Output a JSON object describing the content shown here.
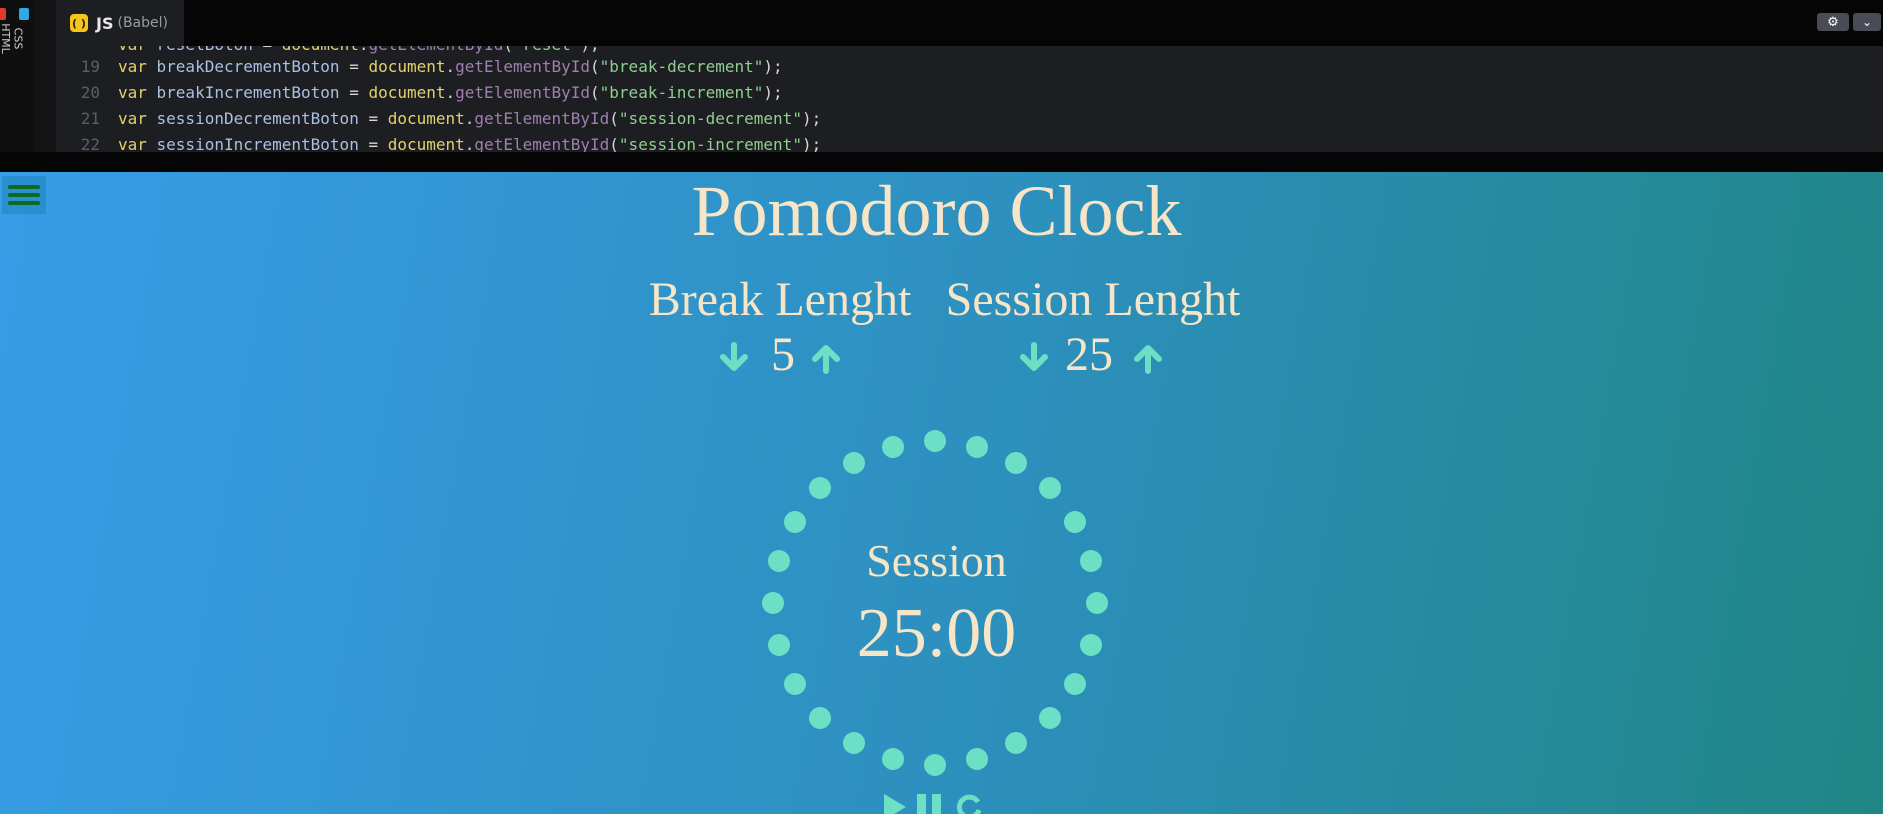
{
  "editor": {
    "vertical_tabs": [
      "HTML",
      "CSS"
    ],
    "active_tab": {
      "title": "JS",
      "subtitle": "(Babel)"
    },
    "code_lines": [
      {
        "num": "",
        "tokens": [
          {
            "t": "var ",
            "c": "kw"
          },
          {
            "t": "resetBoton ",
            "c": "vn"
          },
          {
            "t": "= ",
            "c": "op"
          },
          {
            "t": "document",
            "c": "kw"
          },
          {
            "t": ".",
            "c": "op"
          },
          {
            "t": "getElementById",
            "c": "fn"
          },
          {
            "t": "(",
            "c": "op"
          },
          {
            "t": "\"reset\"",
            "c": "str"
          },
          {
            "t": ");",
            "c": "op"
          }
        ]
      },
      {
        "num": "19",
        "tokens": [
          {
            "t": "var ",
            "c": "kw"
          },
          {
            "t": "breakDecrementBoton ",
            "c": "vn"
          },
          {
            "t": "= ",
            "c": "op"
          },
          {
            "t": "document",
            "c": "kw"
          },
          {
            "t": ".",
            "c": "op"
          },
          {
            "t": "getElementById",
            "c": "fn"
          },
          {
            "t": "(",
            "c": "op"
          },
          {
            "t": "\"break-decrement\"",
            "c": "str"
          },
          {
            "t": ");",
            "c": "op"
          }
        ]
      },
      {
        "num": "20",
        "tokens": [
          {
            "t": "var ",
            "c": "kw"
          },
          {
            "t": "breakIncrementBoton ",
            "c": "vn"
          },
          {
            "t": "= ",
            "c": "op"
          },
          {
            "t": "document",
            "c": "kw"
          },
          {
            "t": ".",
            "c": "op"
          },
          {
            "t": "getElementById",
            "c": "fn"
          },
          {
            "t": "(",
            "c": "op"
          },
          {
            "t": "\"break-increment\"",
            "c": "str"
          },
          {
            "t": ");",
            "c": "op"
          }
        ]
      },
      {
        "num": "21",
        "tokens": [
          {
            "t": "var ",
            "c": "kw"
          },
          {
            "t": "sessionDecrementBoton ",
            "c": "vn"
          },
          {
            "t": "= ",
            "c": "op"
          },
          {
            "t": "document",
            "c": "kw"
          },
          {
            "t": ".",
            "c": "op"
          },
          {
            "t": "getElementById",
            "c": "fn"
          },
          {
            "t": "(",
            "c": "op"
          },
          {
            "t": "\"session-decrement\"",
            "c": "str"
          },
          {
            "t": ");",
            "c": "op"
          }
        ]
      },
      {
        "num": "22",
        "tokens": [
          {
            "t": "var ",
            "c": "kw"
          },
          {
            "t": "sessionIncrementBoton ",
            "c": "vn"
          },
          {
            "t": "= ",
            "c": "op"
          },
          {
            "t": "document",
            "c": "kw"
          },
          {
            "t": ".",
            "c": "op"
          },
          {
            "t": "getElementById",
            "c": "fn"
          },
          {
            "t": "(",
            "c": "op"
          },
          {
            "t": "\"session-increment\"",
            "c": "str"
          },
          {
            "t": ");",
            "c": "op"
          }
        ]
      }
    ],
    "icons": {
      "settings": "gear-icon",
      "collapse": "chevron-down-icon"
    }
  },
  "preview": {
    "title": "Pomodoro Clock",
    "break_label": "Break Lenght",
    "session_label": "Session Lenght",
    "break_length": "5",
    "session_length": "25",
    "timer_label": "Session",
    "time_left": "25:00",
    "colors": {
      "text": "#f6e5c6",
      "accent": "#6ce0c4",
      "menu": "#0c6b1c"
    }
  }
}
